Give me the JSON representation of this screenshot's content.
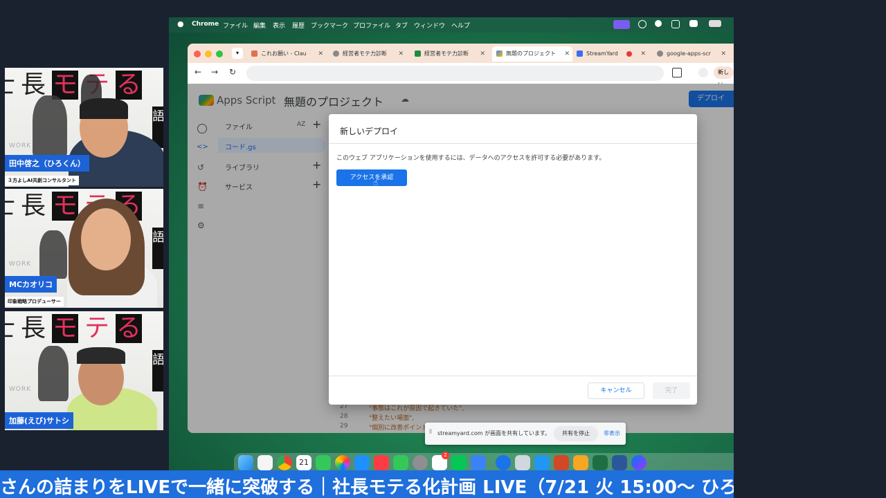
{
  "participants": [
    {
      "name": "田中啓之（ひろくん）",
      "role": "３方よしAI共創コンサルタント"
    },
    {
      "name": "MCカオリコ",
      "role": "印象戦略プロデューサー"
    },
    {
      "name": "加藤(えび)サトシ"
    }
  ],
  "tile_bg": {
    "k1": "長",
    "k2": "モ",
    "k3": "テ",
    "k4": "る",
    "vert": "語",
    "work": "WORK"
  },
  "menubar": {
    "items": [
      "Chrome",
      "ファイル",
      "編集",
      "表示",
      "履歴",
      "ブックマーク",
      "プロファイル",
      "タブ",
      "ウィンドウ",
      "ヘルプ"
    ]
  },
  "browser": {
    "tabs": [
      {
        "title": "これお願い - Clau",
        "color": "#e07050"
      },
      {
        "title": "経営者モテ力診断",
        "color": "#888"
      },
      {
        "title": "経営者モテ力診断",
        "color": "#1e8e3e"
      },
      {
        "title": "無題のプロジェクト",
        "color": "#4285f4"
      },
      {
        "title": "StreamYard",
        "color": "#3b6df0"
      },
      {
        "title": "google-apps-scr",
        "color": "#888"
      }
    ],
    "new_label": "新しい"
  },
  "apps_script": {
    "brand": "Apps Script",
    "project": "無題のプロジェクト",
    "deploy": "デプロイ",
    "files_label": "ファイル",
    "file_item": "コード.gs",
    "libraries": "ライブラリ",
    "services": "サービス",
    "code_lines": [
      {
        "num": "27",
        "text": "\"事態はこれが原因で起きていた\","
      },
      {
        "num": "28",
        "text": "\"整えたい場面\","
      },
      {
        "num": "29",
        "text": "\"個別に改善ポイント\""
      }
    ]
  },
  "dialog": {
    "title": "新しいデプロイ",
    "message": "このウェブ アプリケーションを使用するには、データへのアクセスを許可する必要があります。",
    "authorize": "アクセスを承認",
    "cancel": "キャンセル",
    "done": "完了"
  },
  "sharebar": {
    "text": "streamyard.com が画面を共有しています。",
    "stop": "共有を停止",
    "hide": "非表示"
  },
  "dock_badge": "2",
  "calendar_day": "21",
  "ticker": "さんの詰まりをLIVEで一緒に突破する｜社長モテる化計画 LIVE（7/21 火 15:00〜 ひろ"
}
